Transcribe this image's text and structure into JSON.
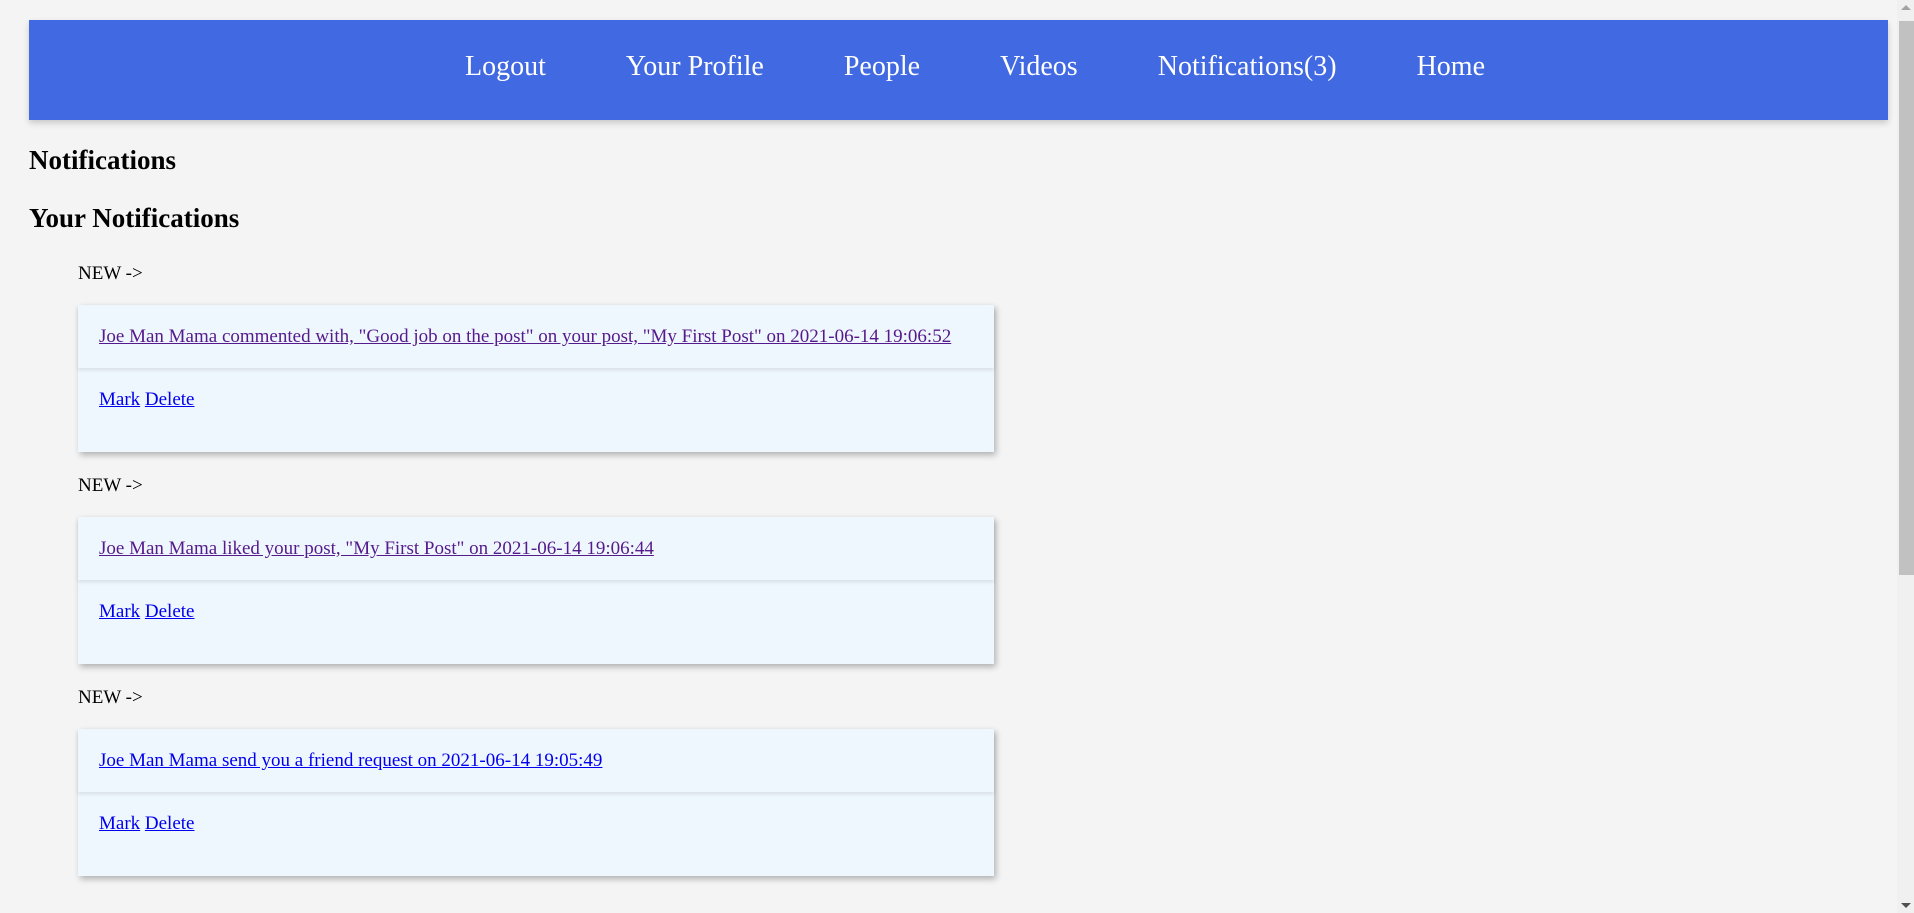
{
  "nav": {
    "items": [
      {
        "label": "Logout"
      },
      {
        "label": "Your Profile"
      },
      {
        "label": "People"
      },
      {
        "label": "Videos"
      },
      {
        "label": "Notifications(3)"
      },
      {
        "label": "Home"
      }
    ],
    "background_color": "#4169e1"
  },
  "page": {
    "title": "Notifications",
    "subtitle": "Your Notifications"
  },
  "notifications": [
    {
      "new_label": "NEW ->",
      "text": "Joe Man Mama commented with, \"Good job on the post\" on your post, \"My First Post\" on 2021-06-14 19:06:52",
      "visited": true,
      "mark_label": "Mark",
      "delete_label": "Delete"
    },
    {
      "new_label": "NEW ->",
      "text": "Joe Man Mama liked your post, \"My First Post\" on 2021-06-14 19:06:44",
      "visited": true,
      "mark_label": "Mark",
      "delete_label": "Delete"
    },
    {
      "new_label": "NEW ->",
      "text": "Joe Man Mama send you a friend request on 2021-06-14 19:05:49",
      "visited": false,
      "mark_label": "Mark",
      "delete_label": "Delete"
    }
  ],
  "colors": {
    "link_visited": "#551a8b",
    "link_unvisited": "#0000ee",
    "card_background": "#eef6fe",
    "page_background": "#f4f4f4"
  }
}
